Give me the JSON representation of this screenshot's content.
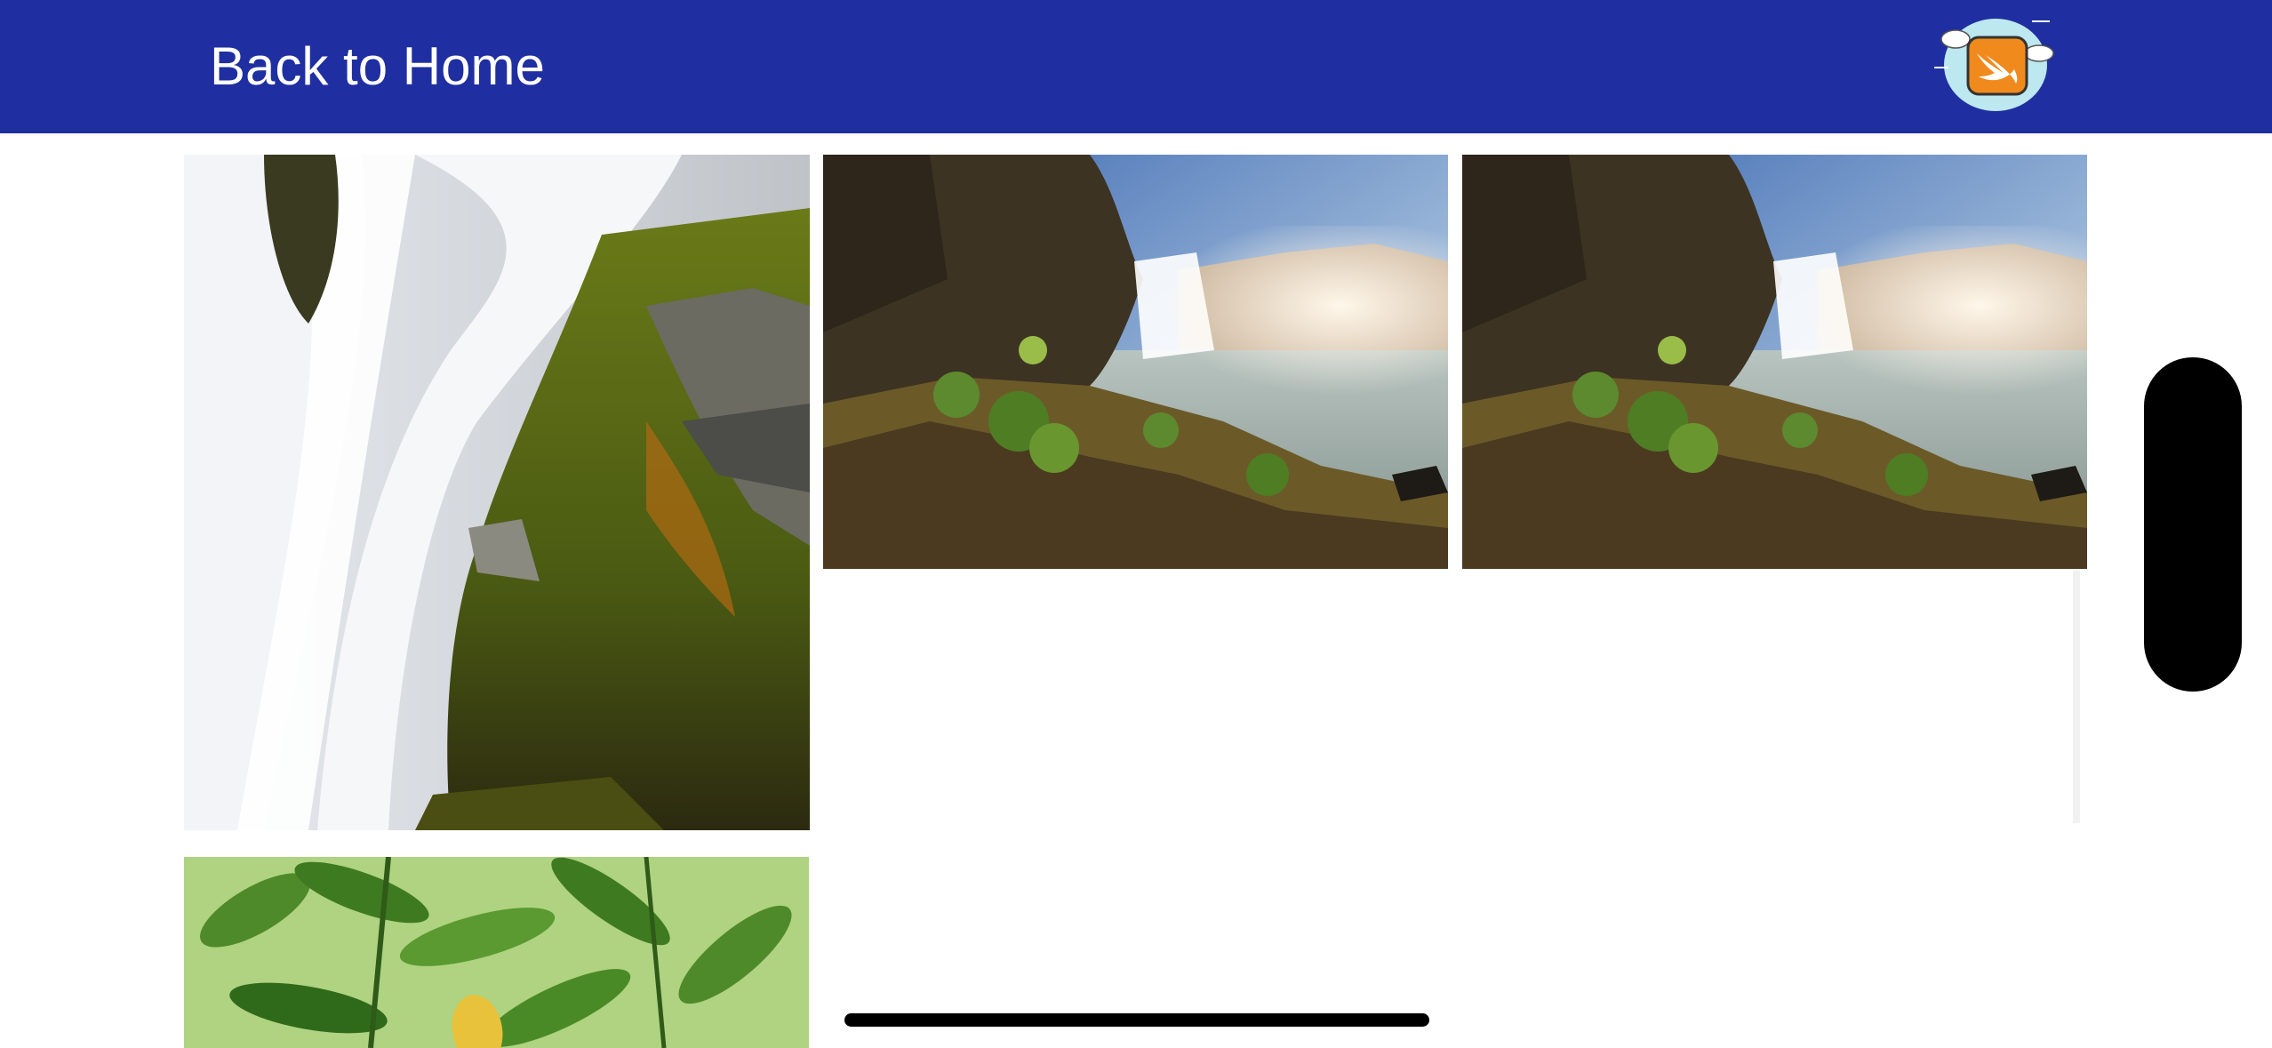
{
  "header": {
    "back_label": "Back to Home",
    "background": "#1f2ea0",
    "logo_icon": "swift-logo-icon"
  },
  "gallery": {
    "photos": [
      {
        "subject": "mossy-waterfall-closeup"
      },
      {
        "subject": "waterfall-with-sunlit-rocks"
      },
      {
        "subject": "waterfall-with-sunlit-rocks"
      },
      {
        "subject": "green-leaves-with-yellow-leaf"
      }
    ]
  },
  "colors": {
    "accent_orange": "#f08a1c",
    "logo_cloud": "#bde8f0",
    "scroll_handle": "#000000"
  }
}
